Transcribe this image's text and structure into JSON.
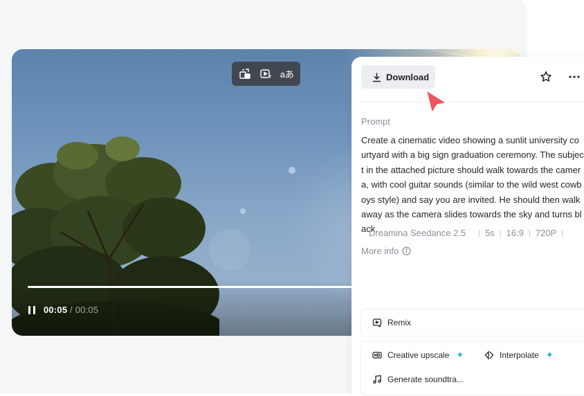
{
  "video": {
    "current_time": "00:05",
    "separator": " / ",
    "duration": "00:05",
    "progress_fraction": 1.0,
    "state": "playing"
  },
  "toolbar": {
    "items": [
      {
        "icon": "picture-swap-icon"
      },
      {
        "icon": "ai-video-icon"
      },
      {
        "icon": "translate-icon",
        "text": "aあ"
      }
    ]
  },
  "panel": {
    "download_label": "Download",
    "prompt_label": "Prompt",
    "prompt_text": "Create a cinematic video showing a sunlit university courtyard with a big sign graduation ceremony. The subject in the attached picture should walk towards the camera, with cool guitar sounds (similar to the wild west cowboys style) and say you are invited. He should then walk away as the camera slides towards the sky and turns black.",
    "meta": {
      "model": "Dreamina Seedance 2.5",
      "duration": "5s",
      "ratio": "16:9",
      "resolution": "720P"
    },
    "more_info_label": "More info"
  },
  "actions": {
    "remix": "Remix",
    "creative_upscale": "Creative upscale",
    "interpolate": "Interpolate",
    "generate_soundtrack": "Generate soundtra...",
    "sparkle": "✦"
  },
  "colors": {
    "accent_sparkle": "#1cb8c8",
    "cursor": "#f0535e",
    "panel_bg": "#ffffff",
    "page_bg": "#f5f6f8"
  }
}
